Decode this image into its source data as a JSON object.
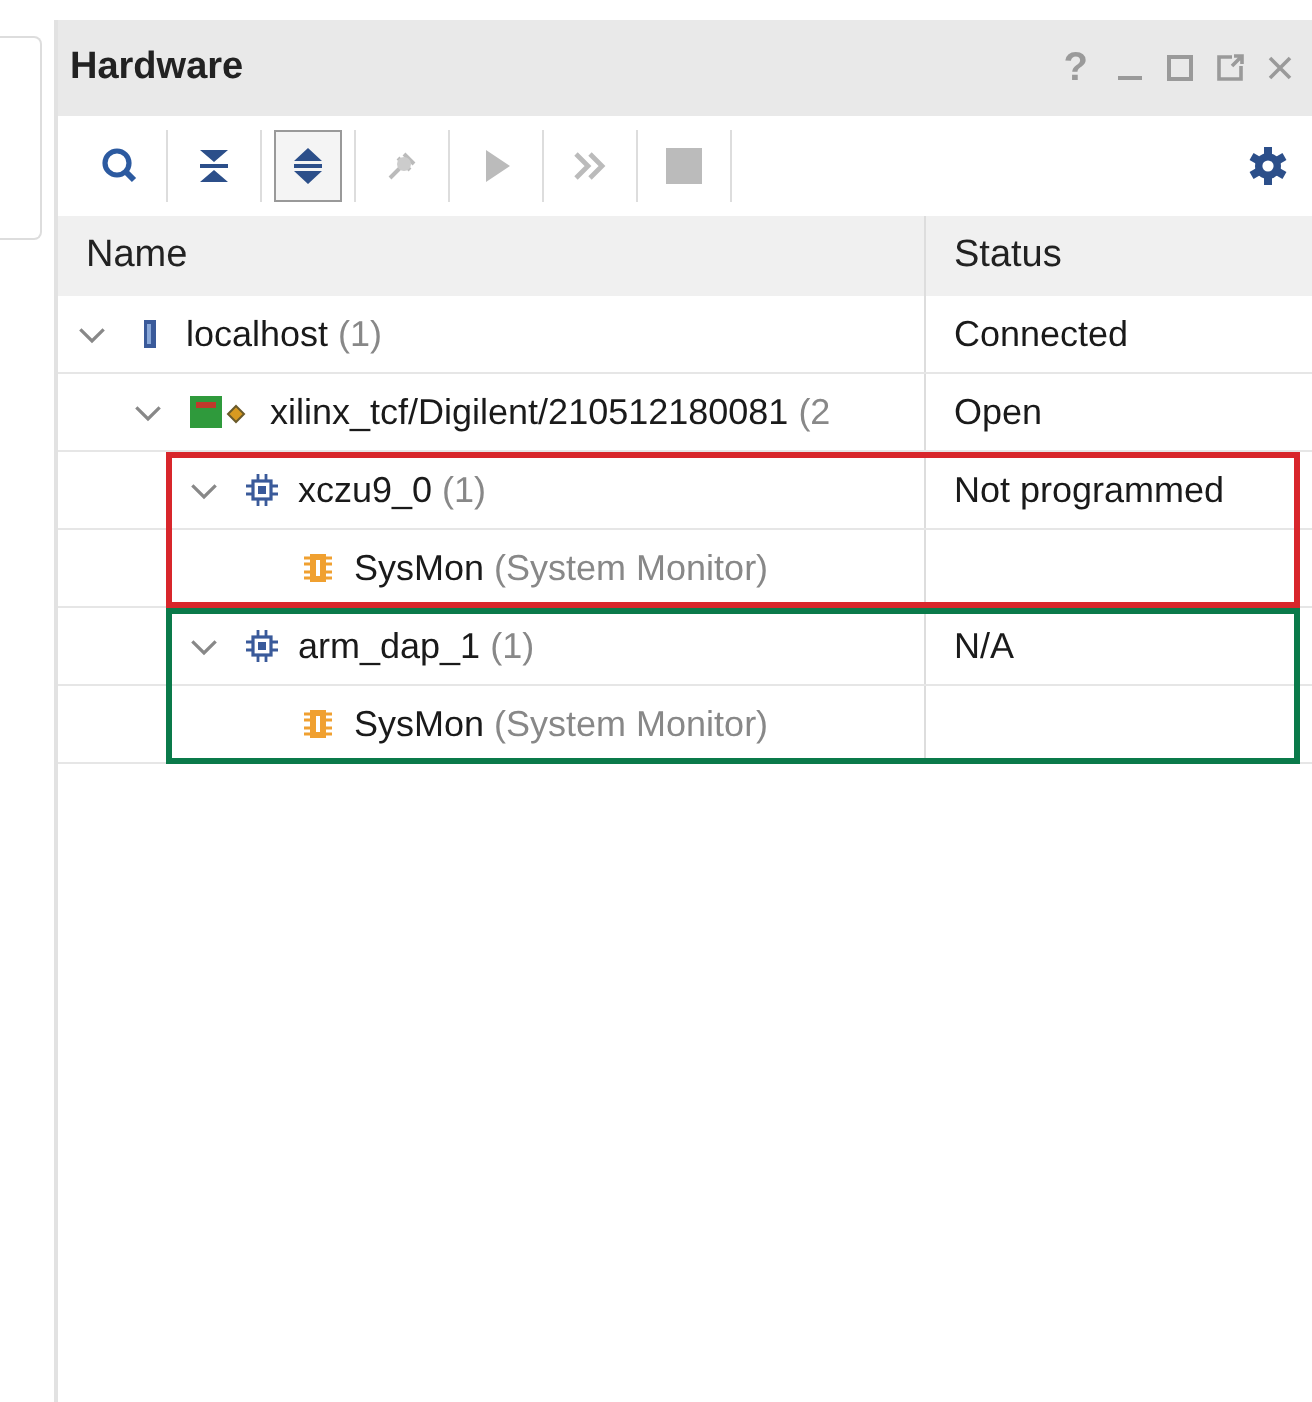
{
  "panel": {
    "title": "Hardware",
    "help": "?"
  },
  "toolbar": [
    {
      "kind": "search",
      "selected": false,
      "disabled": false
    },
    {
      "kind": "collapse",
      "selected": false,
      "disabled": false
    },
    {
      "kind": "expand",
      "selected": true,
      "disabled": false
    },
    {
      "kind": "program",
      "selected": false,
      "disabled": true
    },
    {
      "kind": "run",
      "selected": false,
      "disabled": true
    },
    {
      "kind": "skip",
      "selected": false,
      "disabled": true
    },
    {
      "kind": "stop",
      "selected": false,
      "disabled": true
    }
  ],
  "columns": [
    "Name",
    "Status"
  ],
  "tree": [
    {
      "kind": "host",
      "name": "localhost",
      "count": "(1)",
      "status": "Connected",
      "expanded": true,
      "children": [
        {
          "kind": "target",
          "name": "xilinx_tcf/Digilent/210512180081",
          "count": "(2",
          "status": "Open",
          "expanded": true,
          "children": [
            {
              "kind": "device",
              "name": "xczu9_0",
              "count": "(1)",
              "status": "Not programmed",
              "expanded": true,
              "color": "#d8262b",
              "children": [
                {
                  "kind": "monitor",
                  "name": "SysMon",
                  "count": "(System Monitor)"
                }
              ]
            },
            {
              "kind": "device",
              "name": "arm_dap_1",
              "count": "(1)",
              "status": "N/A",
              "expanded": true,
              "color": "#0a7a4a",
              "children": [
                {
                  "kind": "monitor",
                  "name": "SysMon",
                  "count": "(System Monitor)"
                }
              ]
            }
          ]
        }
      ]
    }
  ]
}
